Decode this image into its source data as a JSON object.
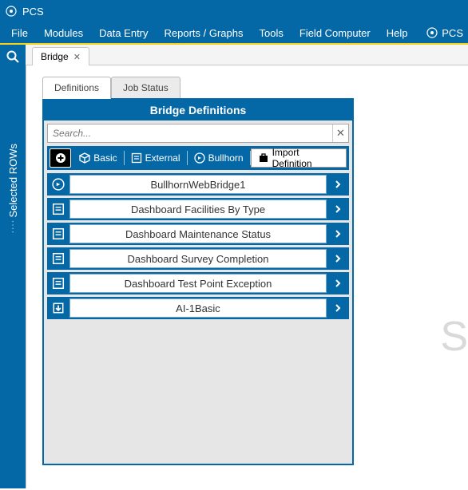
{
  "app": {
    "title": "PCS",
    "brand": "PCS"
  },
  "menu": {
    "items": [
      "File",
      "Modules",
      "Data Entry",
      "Reports / Graphs",
      "Tools",
      "Field Computer",
      "Help"
    ]
  },
  "leftrail": {
    "label": "Selected ROWs"
  },
  "document_tabs": [
    {
      "label": "Bridge"
    }
  ],
  "inner_tabs": [
    {
      "label": "Definitions",
      "active": true
    },
    {
      "label": "Job Status",
      "active": false
    }
  ],
  "panel": {
    "title": "Bridge Definitions",
    "search_placeholder": "Search...",
    "toolbar": {
      "basic": "Basic",
      "external": "External",
      "bullhorn": "Bullhorn",
      "import": "Import Definition"
    },
    "items": [
      {
        "icon": "bullhorn",
        "label": "BullhornWebBridge1"
      },
      {
        "icon": "external",
        "label": "Dashboard Facilities By Type"
      },
      {
        "icon": "external",
        "label": "Dashboard Maintenance Status"
      },
      {
        "icon": "external",
        "label": "Dashboard Survey Completion"
      },
      {
        "icon": "external",
        "label": "Dashboard Test Point Exception"
      },
      {
        "icon": "import",
        "label": "AI-1Basic"
      }
    ]
  },
  "faded_watermark": "S"
}
